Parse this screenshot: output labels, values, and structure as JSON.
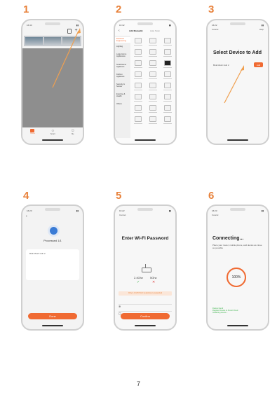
{
  "page_number": "7",
  "steps": [
    {
      "number": "1"
    },
    {
      "number": "2"
    },
    {
      "number": "3"
    },
    {
      "number": "4"
    },
    {
      "number": "5"
    },
    {
      "number": "6"
    }
  ],
  "p1": {
    "time": "16:43",
    "add_icon": "plus-icon",
    "tab_labels": [
      "Home",
      "Smart",
      "Me"
    ]
  },
  "p2": {
    "time": "16:32",
    "tab_manual": "Add Manually",
    "tab_auto": "Auto Scan",
    "categories": [
      "Electrical Engineering",
      "Lighting",
      "Large Home Appliances",
      "Small Home Appliance",
      "Kitchen Appliance",
      "Security & Sensor",
      "Exercise & Health",
      "Others"
    ]
  },
  "p3": {
    "time": "16:22",
    "cancel": "Cancel",
    "help": "Help",
    "title": "Select Device to Add",
    "device": "BLE Mesh Hub 2",
    "add_btn": "Add"
  },
  "p4": {
    "time": "16:23",
    "status": "Processed 1/1",
    "device": "BLE Mesh Hub 2",
    "done": "Done"
  },
  "p5": {
    "time": "16:22",
    "cancel": "Cancel",
    "title": "Enter Wi-Fi Password",
    "band_24": "2.4Ghz",
    "band_5": "5Ghz",
    "warning": "Only 2.4 GHz Wi-Fi networks are supported",
    "confirm": "Confirm"
  },
  "p6": {
    "time": "16:23",
    "cancel": "Cancel",
    "title": "Connecting...",
    "subtitle": "Place your router, mobile phone, and device as close as possible",
    "progress_label": "100%",
    "progress_value": 1.0,
    "status_lines": [
      "Device found",
      "Register Device to Smart Cloud",
      "Initializing device..."
    ]
  },
  "colors": {
    "accent": "#e8813a",
    "button": "#f06a32",
    "blue": "#3a7bd5",
    "success": "#3bb34a"
  }
}
